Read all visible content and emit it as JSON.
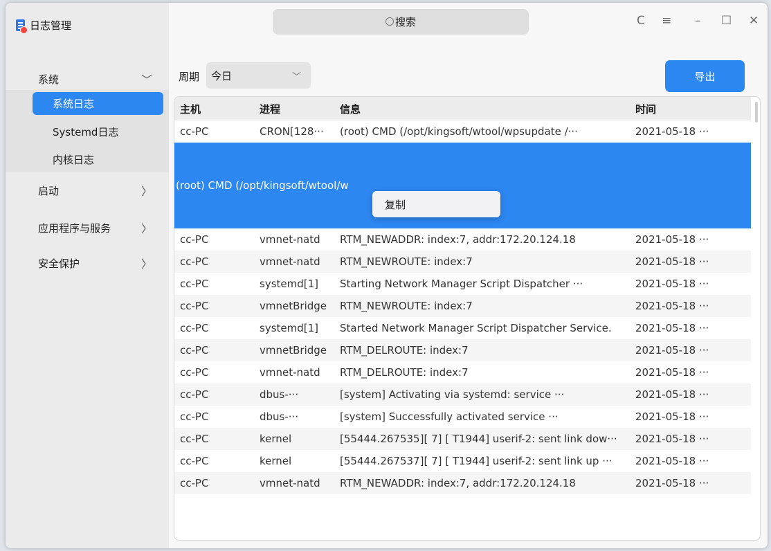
{
  "app": {
    "title": "日志管理",
    "accent_color": "#2d87f1"
  },
  "search": {
    "label": "搜索",
    "icon": "search-icon"
  },
  "window_controls": {
    "refresh": "C",
    "menu": "≡",
    "minimize": "–",
    "maximize": "☐",
    "close": "✕"
  },
  "sidebar": {
    "groups": [
      {
        "label": "系统",
        "chevron": "﹀"
      },
      {
        "label": "启动",
        "chevron": "〉"
      },
      {
        "label": "应用程序与服务",
        "chevron": "〉"
      },
      {
        "label": "安全保护",
        "chevron": "〉"
      }
    ],
    "sub_items": [
      {
        "label": "系统日志",
        "active": true
      },
      {
        "label": "Systemd日志",
        "active": false
      },
      {
        "label": "内核日志",
        "active": false
      }
    ]
  },
  "filter": {
    "period_label": "周期",
    "period_value": "今日",
    "chevron": "﹀"
  },
  "export_label": "导出",
  "table": {
    "headers": [
      "主机",
      "进程",
      "信息",
      "时间"
    ],
    "rows": [
      {
        "host": "cc-PC",
        "process": "CRON[128···",
        "info": "(root) CMD (/opt/kingsoft/wtool/wpsupdate /···",
        "time": "2021-05-18 ···"
      },
      {
        "host": "",
        "process": "",
        "info": "(root) CMD (/opt/kingsoft/wtool/w",
        "time": "",
        "selected": true
      },
      {
        "host": "cc-PC",
        "process": "vmnet-natd",
        "info": "RTM_NEWADDR: index:7, addr:172.20.124.18",
        "time": "2021-05-18 ···"
      },
      {
        "host": "cc-PC",
        "process": "vmnet-natd",
        "info": "RTM_NEWROUTE: index:7",
        "time": "2021-05-18 ···"
      },
      {
        "host": "cc-PC",
        "process": "systemd[1]",
        "info": "Starting Network Manager Script Dispatcher ···",
        "time": "2021-05-18 ···"
      },
      {
        "host": "cc-PC",
        "process": "vmnetBridge",
        "info": "RTM_NEWROUTE: index:7",
        "time": "2021-05-18 ···"
      },
      {
        "host": "cc-PC",
        "process": "systemd[1]",
        "info": "Started Network Manager Script Dispatcher Service.",
        "time": "2021-05-18 ···"
      },
      {
        "host": "cc-PC",
        "process": "vmnetBridge",
        "info": "RTM_DELROUTE: index:7",
        "time": "2021-05-18 ···"
      },
      {
        "host": "cc-PC",
        "process": "vmnet-natd",
        "info": "RTM_DELROUTE: index:7",
        "time": "2021-05-18 ···"
      },
      {
        "host": "cc-PC",
        "process": "dbus-···",
        "info": "[system] Activating via systemd: service ···",
        "time": "2021-05-18 ···"
      },
      {
        "host": "cc-PC",
        "process": "dbus-···",
        "info": "[system] Successfully activated service ···",
        "time": "2021-05-18 ···"
      },
      {
        "host": "cc-PC",
        "process": "kernel",
        "info": "[55444.267535][ 7] [ T1944] userif-2: sent link dow···",
        "time": "2021-05-18 ···"
      },
      {
        "host": "cc-PC",
        "process": "kernel",
        "info": "[55444.267537][ 7] [ T1944] userif-2: sent link up ···",
        "time": "2021-05-18 ···"
      },
      {
        "host": "cc-PC",
        "process": "vmnet-natd",
        "info": "RTM_NEWADDR: index:7, addr:172.20.124.18",
        "time": "2021-05-18 ···"
      }
    ]
  },
  "context_menu": {
    "copy_label": "复制"
  }
}
